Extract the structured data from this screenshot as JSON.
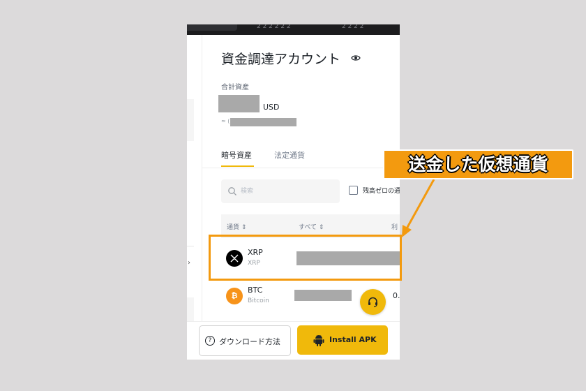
{
  "status_bar": {
    "left_text": "2 2 2 2 2 2",
    "right_text": "2 2 2 2"
  },
  "page": {
    "title": "資金調達アカウント",
    "eye_icon": "eye-icon"
  },
  "balance": {
    "label": "合計資産",
    "currency": "USD",
    "approx_prefix": "≈ ("
  },
  "tabs": [
    {
      "label": "暗号資産",
      "active": true
    },
    {
      "label": "法定通貨",
      "active": false
    }
  ],
  "search": {
    "placeholder": "検索",
    "icon": "search-icon"
  },
  "hide_zero": {
    "label": "残高ゼロの通",
    "checked": false
  },
  "table": {
    "headers": [
      "通貨 ⇕",
      "すべて ⇕",
      "利"
    ],
    "rows": [
      {
        "symbol": "XRP",
        "name": "XRP",
        "icon": "xrp-icon",
        "color": "#000000"
      },
      {
        "symbol": "BTC",
        "name": "Bitcoin",
        "icon": "bitcoin-icon",
        "color": "#f7931a",
        "partial_value": "0."
      }
    ]
  },
  "footer": {
    "download_label": "ダウンロード方法",
    "install_label": "Install APK"
  },
  "annotation": {
    "callout_text": "送金した仮想通貨",
    "color": "#f39a0f"
  },
  "colors": {
    "accent": "#f0b90b",
    "text": "#1e2329"
  }
}
